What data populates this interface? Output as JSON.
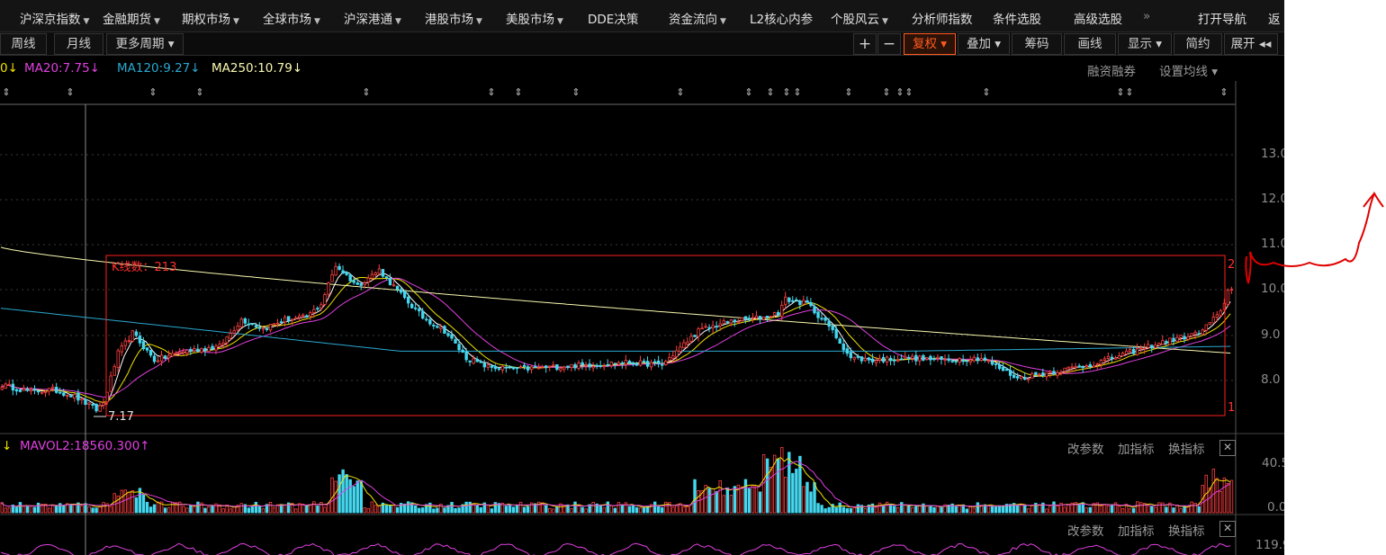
{
  "nav": {
    "items": [
      {
        "label": "沪深京指数",
        "caret": true
      },
      {
        "label": "金融期货",
        "caret": true
      },
      {
        "label": "期权市场",
        "caret": true
      },
      {
        "label": "全球市场",
        "caret": true
      },
      {
        "label": "沪深港通",
        "caret": true
      },
      {
        "label": "港股市场",
        "caret": true
      },
      {
        "label": "美股市场",
        "caret": true
      },
      {
        "label": "DDE决策",
        "caret": false
      },
      {
        "label": "资金流向",
        "caret": true
      },
      {
        "label": "L2核心内参",
        "caret": false
      },
      {
        "label": "个股风云",
        "caret": true
      },
      {
        "label": "分析师指数",
        "caret": false
      },
      {
        "label": "条件选股",
        "caret": false
      },
      {
        "label": "高级选股",
        "caret": false
      }
    ],
    "more": "»",
    "open_nav": "打开导航",
    "back": "返"
  },
  "toolbar": {
    "periods": [
      "周线",
      "月线",
      "更多周期 ▾"
    ],
    "plus": "+",
    "minus": "−",
    "fuquan": "复权 ▾",
    "overlay": "叠加 ▾",
    "chips": "筹码",
    "draw": "画线",
    "display": "显示 ▾",
    "simple": "简约",
    "expand": "展开 ◂◂"
  },
  "ma_legend": {
    "ma10": "0↓",
    "ma20": "MA20:7.75↓",
    "ma120": "MA120:9.27↓",
    "ma250": "MA250:10.79↓",
    "margin": "融资融券",
    "set_ma": "设置均线 ▾"
  },
  "colors": {
    "up": "#ff4040",
    "down": "#44d8f0",
    "ma_white": "#ffffff",
    "ma_yellow": "#f0e000",
    "ma_magenta": "#e040e0",
    "ma_cyan": "#2aa8d0",
    "ma_long": "#f8f8b0",
    "selection_box": "#ff2020",
    "accent": "#ff5a1e"
  },
  "price_axis": [
    "13.0",
    "12.0",
    "11.0",
    "10.0",
    "9.0",
    "8.0"
  ],
  "selection": {
    "label": "K线数：213",
    "right_top": "2",
    "right_bottom": "1",
    "low_label": "7.17"
  },
  "volume_panel": {
    "legend": "MAVOL2:18560.300↑",
    "legend_prefix": "↓",
    "buttons": [
      "改参数",
      "加指标",
      "换指标"
    ],
    "close": "✕",
    "axis": [
      "40.5",
      "0.0"
    ]
  },
  "lower_panel": {
    "buttons": [
      "改参数",
      "加指标",
      "换指标"
    ],
    "close": "✕",
    "axis": [
      "119.9"
    ]
  },
  "chart_data": {
    "type": "candlestick",
    "ylim": [
      7.0,
      13.3
    ],
    "bar_count_label": "K线数：213",
    "low_marker": 7.17,
    "ma_values": {
      "MA20": 7.75,
      "MA120": 9.27,
      "MA250": 10.79
    },
    "mavol2": 18560.3,
    "volume_ylim": [
      0.0,
      40.5
    ],
    "anchors": [
      [
        0,
        7.9
      ],
      [
        8,
        7.75
      ],
      [
        14,
        7.8
      ],
      [
        20,
        7.65
      ],
      [
        26,
        7.35
      ],
      [
        28,
        7.5
      ],
      [
        32,
        8.6
      ],
      [
        36,
        9.05
      ],
      [
        42,
        8.45
      ],
      [
        50,
        8.65
      ],
      [
        60,
        8.75
      ],
      [
        66,
        9.35
      ],
      [
        72,
        9.15
      ],
      [
        78,
        9.35
      ],
      [
        84,
        9.4
      ],
      [
        88,
        9.7
      ],
      [
        92,
        10.55
      ],
      [
        98,
        10.1
      ],
      [
        104,
        10.45
      ],
      [
        110,
        9.9
      ],
      [
        116,
        9.4
      ],
      [
        122,
        9.1
      ],
      [
        128,
        8.5
      ],
      [
        134,
        8.3
      ],
      [
        142,
        8.25
      ],
      [
        152,
        8.3
      ],
      [
        162,
        8.35
      ],
      [
        172,
        8.4
      ],
      [
        182,
        8.35
      ],
      [
        192,
        9.1
      ],
      [
        200,
        9.3
      ],
      [
        210,
        9.4
      ],
      [
        214,
        9.5
      ],
      [
        216,
        9.8
      ],
      [
        222,
        9.7
      ],
      [
        228,
        9.2
      ],
      [
        234,
        8.5
      ],
      [
        240,
        8.45
      ],
      [
        250,
        8.5
      ],
      [
        260,
        8.45
      ],
      [
        270,
        8.5
      ],
      [
        280,
        8.05
      ],
      [
        290,
        8.2
      ],
      [
        300,
        8.35
      ],
      [
        310,
        8.6
      ],
      [
        320,
        8.85
      ],
      [
        330,
        9.05
      ],
      [
        336,
        9.5
      ],
      [
        338,
        10.0
      ]
    ]
  }
}
